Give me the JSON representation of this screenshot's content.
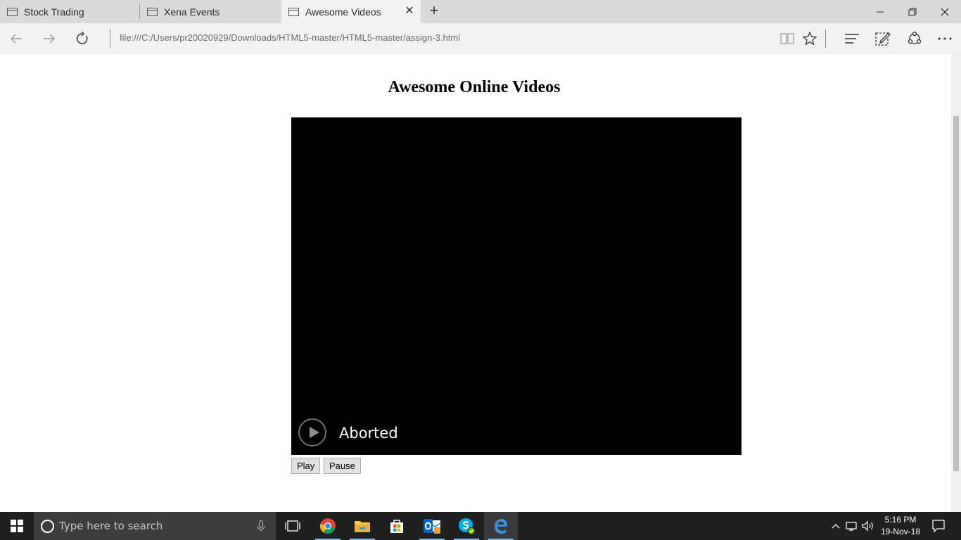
{
  "browser": {
    "tabs": [
      {
        "label": "Stock Trading"
      },
      {
        "label": "Xena Events"
      },
      {
        "label": "Awesome Videos"
      }
    ],
    "url": "file:///C:/Users/pr20020929/Downloads/HTML5-master/HTML5-master/assign-3.html"
  },
  "page": {
    "heading": "Awesome Online Videos",
    "video_status": "Aborted",
    "play_label": "Play",
    "pause_label": "Pause"
  },
  "taskbar": {
    "search_placeholder": "Type here to search",
    "time": "5:16 PM",
    "date": "19-Nov-18"
  },
  "colors": {
    "tab_bar": "#dadada",
    "active_tab": "#f2f2f2",
    "video_bg": "#000000",
    "taskbar": "#1f1f1f",
    "edge_blue": "#0078d7"
  }
}
